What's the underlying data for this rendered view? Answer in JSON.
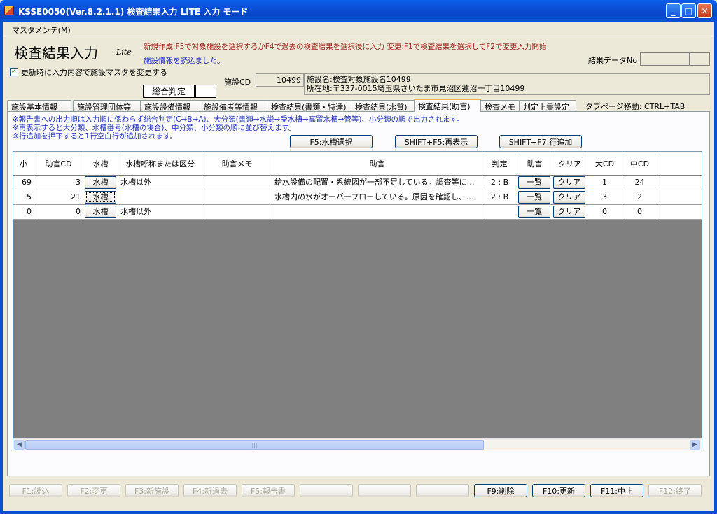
{
  "window": {
    "title": "KSSE0050(Ver.8.2.1.1) 検査結果入力 LITE 入力 モード",
    "min": "_",
    "max": "□",
    "close": "✕"
  },
  "menu": {
    "maintenance": "マスタメンテ(M)"
  },
  "header": {
    "title": "検査結果入力",
    "lite": "Lite",
    "help": "新規作成:F3で対象施設を選択するかF4で過去の検査結果を選択後に入力  変更:F1で検査結果を選択してF2で変更入力開始",
    "info": "施設情報を読込ました。",
    "result_no_label": "結果データNo",
    "update_master_label": "更新時に入力内容で施設マスタを変更する",
    "update_master_checked": true,
    "overall_label": "総合判定",
    "facility_cd_label": "施設CD",
    "facility_cd": "10499",
    "facility_name": "施設名:検査対象施設名10499",
    "facility_address": "所在地:〒337-0015埼玉県さいたま市見沼区蓮沼一丁目10499"
  },
  "tabs": [
    {
      "label": "施設基本情報",
      "active": false
    },
    {
      "label": "施設管理団体等",
      "active": false
    },
    {
      "label": "施設設備情報",
      "active": false
    },
    {
      "label": "施設備考等情報",
      "active": false
    },
    {
      "label": "検査結果(書類・特達)",
      "active": false
    },
    {
      "label": "検査結果(水質)",
      "active": false
    },
    {
      "label": "検査結果(助言)",
      "active": true
    },
    {
      "label": "検査メモ",
      "active": false
    },
    {
      "label": "判定上書設定",
      "active": false
    }
  ],
  "tab_hint": "タブページ移動: CTRL+TAB",
  "notes": [
    "※報告書への出力順は入力順に係わらず総合判定(C→B→A)、大分類(書類→水説→受水槽→高置水槽→管等)、小分類の順で出力されます。",
    "※再表示すると大分類、水槽番号(水槽の場合)、中分類、小分類の順に並び替えます。",
    "※行追加を押下すると1行空白行が追加されます。"
  ],
  "actions": {
    "select_tank": "F5:水槽選択",
    "refresh": "SHIFT+F5:再表示",
    "add_row": "SHIFT+F7:行追加"
  },
  "grid": {
    "columns": [
      "小",
      "助言CD",
      "水槽",
      "水槽呼称または区分",
      "助言メモ",
      "助言",
      "判定",
      "助言",
      "クリア",
      "大CD",
      "中CD"
    ],
    "rows": [
      {
        "small": "69",
        "advice_cd": "3",
        "tank_btn": "水槽",
        "tank_name": "水槽以外",
        "memo": "",
        "advice": "給水設備の配置・系統図が一部不足している。調査等に…",
        "judge": "2 : B",
        "list_btn": "一覧",
        "clear_btn": "クリア",
        "large_cd": "1",
        "mid_cd": "24"
      },
      {
        "small": "5",
        "advice_cd": "21",
        "tank_btn": "水槽",
        "tank_name": "",
        "memo": "",
        "advice": "水槽内の水がオーバーフローしている。原因を確認し、…",
        "judge": "2 : B",
        "list_btn": "一覧",
        "clear_btn": "クリア",
        "large_cd": "3",
        "mid_cd": "2"
      },
      {
        "small": "0",
        "advice_cd": "0",
        "tank_btn": "水槽",
        "tank_name": "水槽以外",
        "memo": "",
        "advice": "",
        "judge": "",
        "list_btn": "一覧",
        "clear_btn": "クリア",
        "large_cd": "0",
        "mid_cd": "0"
      }
    ]
  },
  "fkeys": [
    {
      "label": "F1:読込",
      "enabled": false
    },
    {
      "label": "F2:変更",
      "enabled": false
    },
    {
      "label": "F3:新施設",
      "enabled": false
    },
    {
      "label": "F4:新過去",
      "enabled": false
    },
    {
      "label": "F5:報告書",
      "enabled": false
    },
    {
      "label": "",
      "enabled": false
    },
    {
      "label": "",
      "enabled": false
    },
    {
      "label": "",
      "enabled": false
    },
    {
      "label": "F9:削除",
      "enabled": true
    },
    {
      "label": "F10:更新",
      "enabled": true
    },
    {
      "label": "F11:中止",
      "enabled": true
    },
    {
      "label": "F12:終了",
      "enabled": false
    }
  ]
}
